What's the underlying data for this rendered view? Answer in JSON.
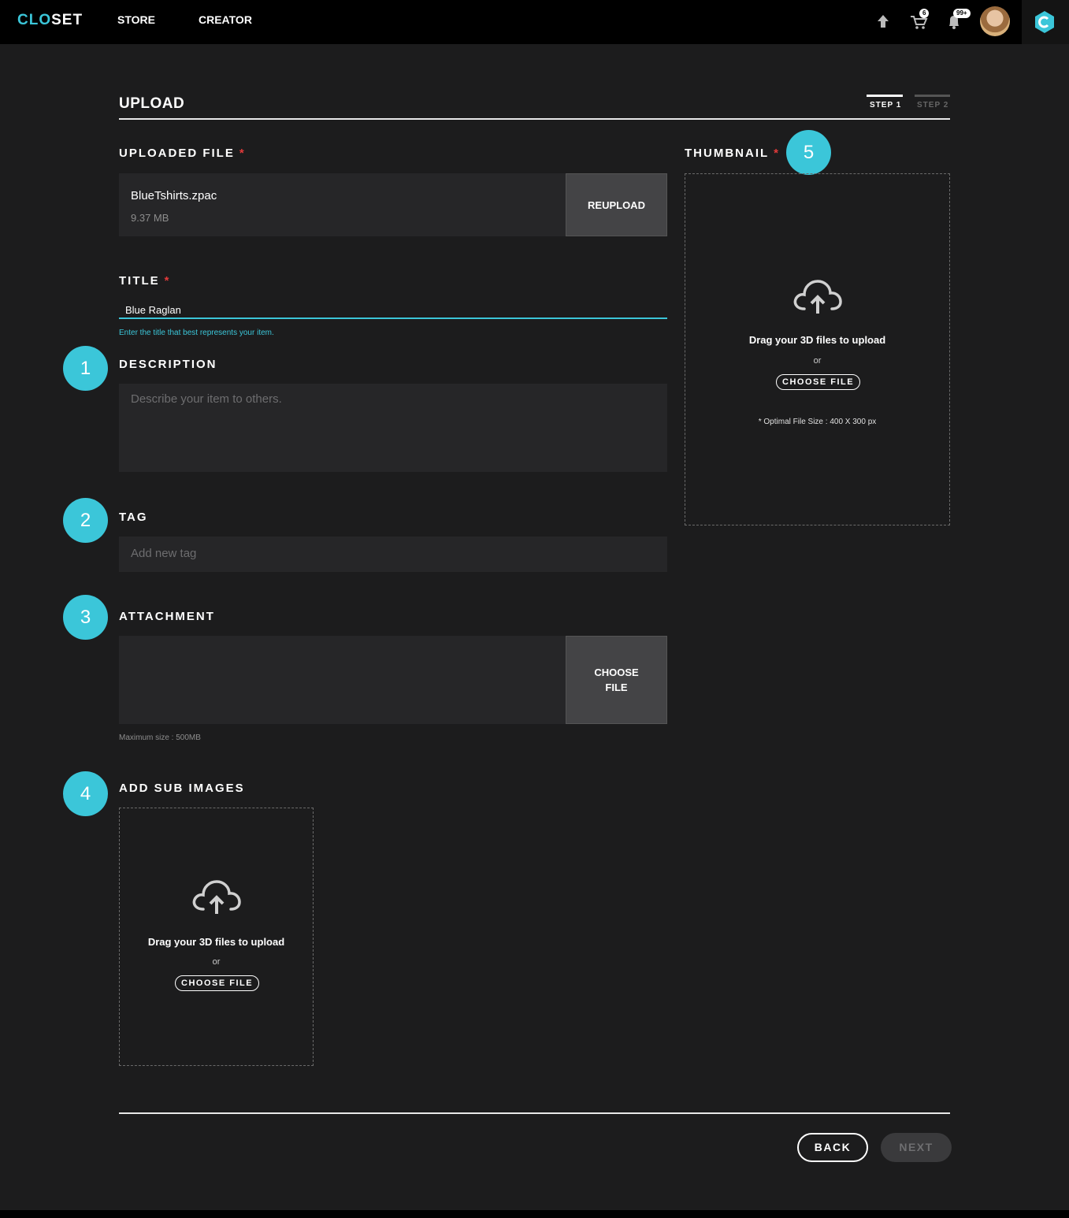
{
  "topbar": {
    "logo_clo": "CLO",
    "logo_set": "SET",
    "nav": [
      "STORE",
      "CREATOR"
    ],
    "cart_count": "6",
    "notification_count": "99+"
  },
  "page": {
    "title": "UPLOAD",
    "steps": [
      "STEP 1",
      "STEP 2"
    ],
    "active_step": 1
  },
  "uploaded_file": {
    "label": "UPLOADED FILE",
    "required": "*",
    "file_name": "BlueTshirts.zpac",
    "file_size": "9.37 MB",
    "button": "REUPLOAD"
  },
  "title_field": {
    "label": "TITLE",
    "required": "*",
    "value": "Blue Raglan",
    "hint": "Enter the title that best represents your item."
  },
  "description": {
    "label": "DESCRIPTION",
    "placeholder": "Describe your item to others."
  },
  "tag": {
    "label": "TAG",
    "placeholder": "Add new tag"
  },
  "attachment": {
    "label": "ATTACHMENT",
    "button_line1": "CHOOSE",
    "button_line2": "FILE",
    "hint": "Maximum size : 500MB"
  },
  "sub_images": {
    "label": "ADD SUB IMAGES",
    "drag_text": "Drag your 3D files to upload",
    "or": "or",
    "button": "CHOOSE FILE"
  },
  "thumbnail": {
    "label": "THUMBNAIL",
    "required": "*",
    "drag_text": "Drag your 3D files to upload",
    "or": "or",
    "button": "CHOOSE FILE",
    "size_hint": "* Optimal File Size : 400 X 300 px"
  },
  "markers": [
    "1",
    "2",
    "3",
    "4",
    "5"
  ],
  "footer": {
    "back": "BACK",
    "next": "NEXT"
  },
  "colors": {
    "accent": "#3bc6d9",
    "required": "#e23a3a",
    "background": "#1c1c1d",
    "field": "#262628"
  }
}
